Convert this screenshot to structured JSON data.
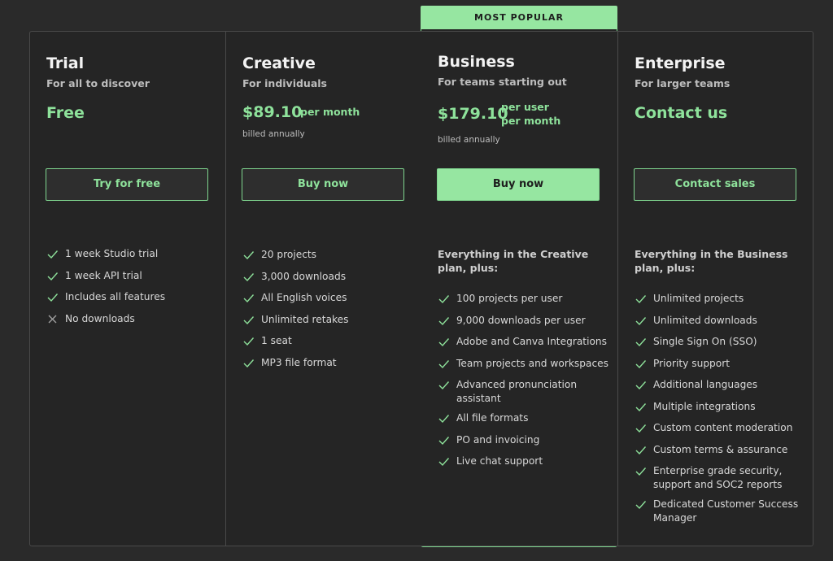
{
  "popular_badge": "MOST POPULAR",
  "plans": [
    {
      "name": "Trial",
      "subtitle": "For all to discover",
      "price": "Free",
      "cta": "Try for free",
      "features": [
        {
          "text": "1 week Studio trial",
          "icon": "check-icon"
        },
        {
          "text": "1 week API trial",
          "icon": "check-icon"
        },
        {
          "text": "Includes all features",
          "icon": "check-icon"
        },
        {
          "text": "No downloads",
          "icon": "x-icon"
        }
      ]
    },
    {
      "name": "Creative",
      "subtitle": "For individuals",
      "price": "$89.10",
      "period": "per month",
      "billing": "billed annually",
      "cta": "Buy now",
      "features": [
        {
          "text": "20 projects",
          "icon": "check-icon"
        },
        {
          "text": "3,000 downloads",
          "icon": "check-icon"
        },
        {
          "text": "All English voices",
          "icon": "check-icon"
        },
        {
          "text": "Unlimited retakes",
          "icon": "check-icon"
        },
        {
          "text": "1 seat",
          "icon": "check-icon"
        },
        {
          "text": "MP3 file format",
          "icon": "check-icon"
        }
      ]
    },
    {
      "name": "Business",
      "subtitle": "For teams starting out",
      "price": "$179.10",
      "period_line1": "per user",
      "period_line2": "per month",
      "billing": "billed annually",
      "cta": "Buy now",
      "intro": "Everything in the Creative plan, plus:",
      "features": [
        {
          "text": "100 projects per user",
          "icon": "check-icon"
        },
        {
          "text": "9,000 downloads per user",
          "icon": "check-icon"
        },
        {
          "text": "Adobe and Canva Integrations",
          "icon": "check-icon"
        },
        {
          "text": "Team projects and workspaces",
          "icon": "check-icon"
        },
        {
          "text": "Advanced pronunciation assistant",
          "icon": "check-icon"
        },
        {
          "text": "All file formats",
          "icon": "check-icon"
        },
        {
          "text": "PO and invoicing",
          "icon": "check-icon"
        },
        {
          "text": "Live chat support",
          "icon": "check-icon"
        }
      ]
    },
    {
      "name": "Enterprise",
      "subtitle": "For larger teams",
      "price": "Contact us",
      "cta": "Contact sales",
      "intro": "Everything in the Business plan, plus:",
      "features": [
        {
          "text": "Unlimited projects",
          "icon": "check-icon"
        },
        {
          "text": "Unlimited downloads",
          "icon": "check-icon"
        },
        {
          "text": "Single Sign On (SSO)",
          "icon": "check-icon"
        },
        {
          "text": "Priority support",
          "icon": "check-icon"
        },
        {
          "text": "Additional languages",
          "icon": "check-icon"
        },
        {
          "text": "Multiple integrations",
          "icon": "check-icon"
        },
        {
          "text": "Custom content moderation",
          "icon": "check-icon"
        },
        {
          "text": "Custom terms & assurance",
          "icon": "check-icon"
        },
        {
          "text": "Enterprise grade security, support and SOC2 reports",
          "icon": "check-icon"
        },
        {
          "text": "Dedicated Customer Success Manager",
          "icon": "check-icon"
        }
      ]
    }
  ],
  "colors": {
    "accent": "#96e6a1",
    "accent_text": "#8ee29b",
    "background": "#2a2a2a",
    "card": "#252525"
  }
}
